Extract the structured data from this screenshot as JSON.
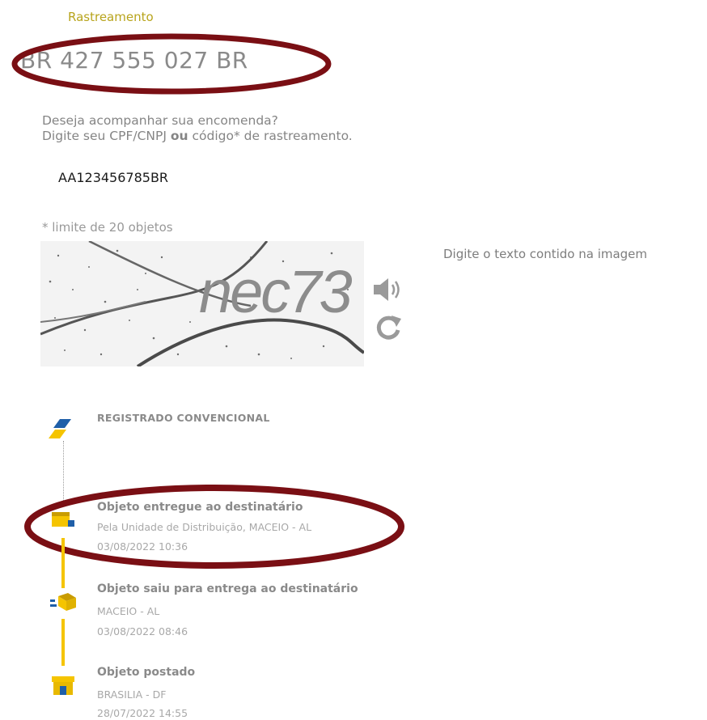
{
  "header": {
    "rastreamento_label": "Rastreamento",
    "tracking_code": "BR 427 555 027 BR"
  },
  "form": {
    "prompt_line1": "Deseja acompanhar sua encomenda?",
    "prompt_line2_a": "Digite seu CPF/CNPJ",
    "prompt_line2_bold": "ou",
    "prompt_line2_b": "código* de rastreamento.",
    "input_value": "AA123456785BR",
    "limit_note": "* limite de 20 objetos"
  },
  "captcha": {
    "text": "nec73",
    "hint": "Digite o texto contido na imagem",
    "audio_icon": "speaker-icon",
    "refresh_icon": "refresh-icon"
  },
  "service": {
    "type": "REGISTRADO CONVENCIONAL",
    "icon": "correios-logo-icon"
  },
  "events": [
    {
      "title": "Objeto entregue ao destinatário",
      "location": "Pela Unidade de Distribuição, MACEIO - AL",
      "datetime": "03/08/2022 10:36",
      "icon": "delivered-icon"
    },
    {
      "title": "Objeto saiu para entrega ao destinatário",
      "location": "MACEIO - AL",
      "datetime": "03/08/2022 08:46",
      "icon": "out-for-delivery-icon"
    },
    {
      "title": "Objeto postado",
      "location": "BRASILIA - DF",
      "datetime": "28/07/2022 14:55",
      "icon": "posted-icon"
    }
  ],
  "colors": {
    "accent_yellow": "#f5c400",
    "annotation_oval": "#7a0f14",
    "rastreamento_label": "#b8a41c",
    "correios_blue": "#1f5fa8"
  }
}
